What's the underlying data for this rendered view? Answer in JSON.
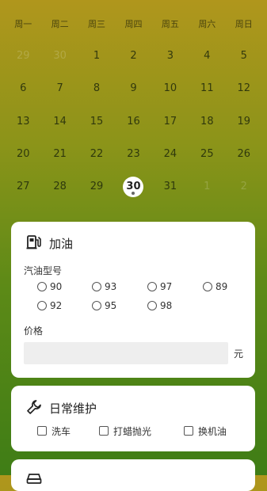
{
  "calendar": {
    "weekdays": [
      "周一",
      "周二",
      "周三",
      "周四",
      "周五",
      "周六",
      "周日"
    ],
    "weeks": [
      [
        "29",
        "30",
        "1",
        "2",
        "3",
        "4",
        "5"
      ],
      [
        "6",
        "7",
        "8",
        "9",
        "10",
        "11",
        "12"
      ],
      [
        "13",
        "14",
        "15",
        "16",
        "17",
        "18",
        "19"
      ],
      [
        "20",
        "21",
        "22",
        "23",
        "24",
        "25",
        "26"
      ],
      [
        "27",
        "28",
        "29",
        "30",
        "31",
        "1",
        "2"
      ]
    ],
    "today": "30"
  },
  "fuel_card": {
    "icon": "fuel-pump-icon",
    "title": "加油",
    "type_label": "汽油型号",
    "options": [
      "90",
      "93",
      "97",
      "89",
      "92",
      "95",
      "98"
    ],
    "price_label": "价格",
    "price_value": "",
    "unit": "元"
  },
  "maintenance_card": {
    "icon": "wrench-icon",
    "title": "日常维护",
    "items": [
      "洗车",
      "打蜡抛光",
      "换机油"
    ]
  },
  "third_card": {
    "icon": "car-icon"
  }
}
